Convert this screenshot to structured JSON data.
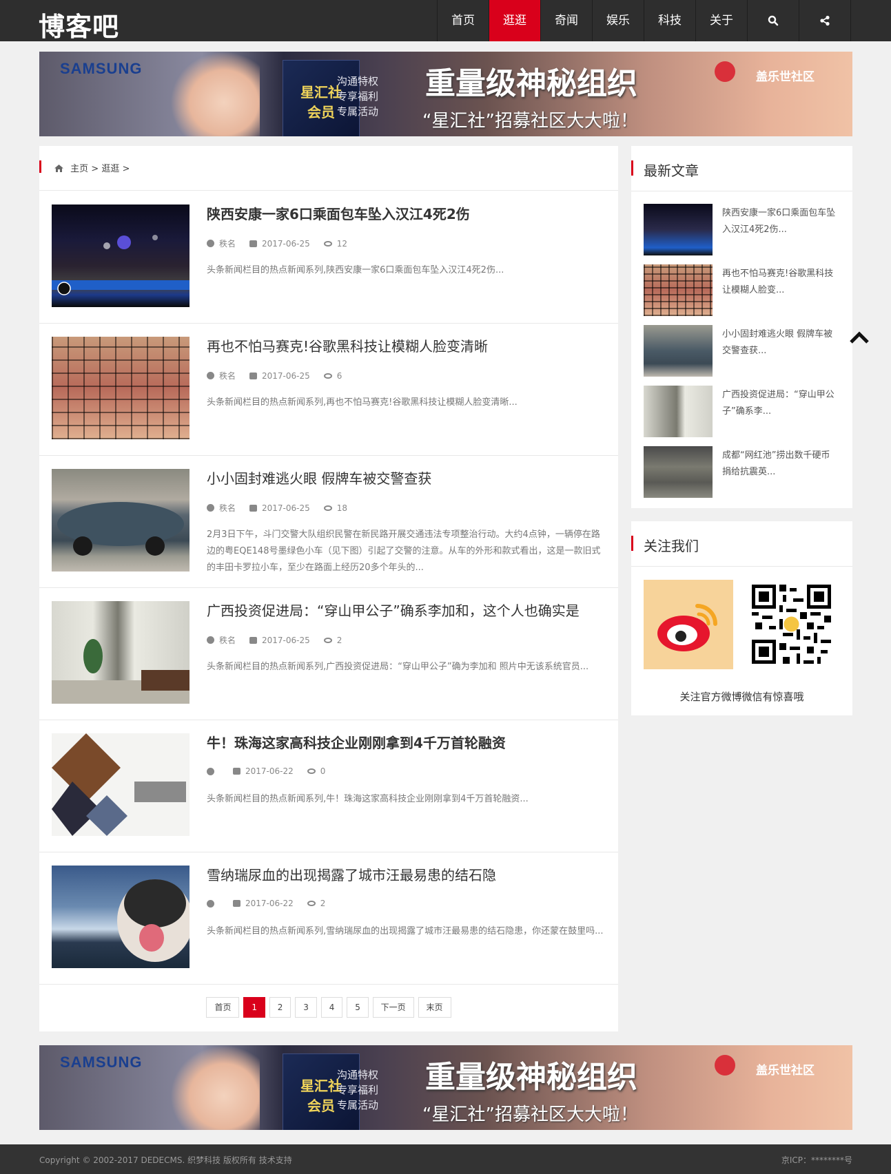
{
  "site": {
    "logo": "博客吧"
  },
  "nav": {
    "items": [
      "首页",
      "逛逛",
      "奇闻",
      "娱乐",
      "科技",
      "关于"
    ],
    "active": "逛逛"
  },
  "banner": {
    "brand_left": "SAMSUNG",
    "card_line1": "星汇社",
    "card_line2": "会员",
    "side_line1": "沟通特权",
    "side_line2": "专享福利",
    "side_line3": "专属活动",
    "headline": "重量级神秘组织",
    "subline": "“星汇社”招募社区大大啦！",
    "brand_right": "盖乐世社区"
  },
  "breadcrumb": {
    "home": "主页",
    "sep1": ">",
    "current": "逛逛",
    "sep2": ">"
  },
  "articles": [
    {
      "title": "陕西安康一家6口乘面包车坠入汉江4死2伤",
      "author": "秩名",
      "date": "2017-06-25",
      "views": "12",
      "desc": "头条新闻栏目的热点新闻系列,陕西安康一家6口乘面包车坠入汉江4死2伤..."
    },
    {
      "title": "再也不怕马赛克!谷歌黑科技让模糊人脸变清晰",
      "author": "秩名",
      "date": "2017-06-25",
      "views": "6",
      "desc": "头条新闻栏目的热点新闻系列,再也不怕马赛克!谷歌黑科技让模糊人脸变清晰..."
    },
    {
      "title": "小小固封难逃火眼 假牌车被交警查获",
      "author": "秩名",
      "date": "2017-06-25",
      "views": "18",
      "desc": "2月3日下午，斗门交警大队组织民警在新民路开展交通违法专项整治行动。大约4点钟，一辆停在路边的粤EQE148号墨绿色小车（见下图）引起了交警的注意。从车的外形和款式看出，这是一款旧式的丰田卡罗拉小车，至少在路面上经历20多个年头的..."
    },
    {
      "title": "广西投资促进局：“穿山甲公子”确系李加和，这个人也确实是",
      "author": "秩名",
      "date": "2017-06-25",
      "views": "2",
      "desc": "头条新闻栏目的热点新闻系列,广西投资促进局：“穿山甲公子”确为李加和 照片中无该系统官员..."
    },
    {
      "title": "牛！珠海这家高科技企业刚刚拿到4千万首轮融资",
      "author": "",
      "date": "2017-06-22",
      "views": "0",
      "desc": "头条新闻栏目的热点新闻系列,牛！珠海这家高科技企业刚刚拿到4千万首轮融资..."
    },
    {
      "title": "雪纳瑞尿血的出现揭露了城市汪最易患的结石隐",
      "author": "",
      "date": "2017-06-22",
      "views": "2",
      "desc": "头条新闻栏目的热点新闻系列,雪纳瑞尿血的出现揭露了城市汪最易患的结石隐患，你还蒙在鼓里吗..."
    }
  ],
  "pager": {
    "first": "首页",
    "pages": [
      "1",
      "2",
      "3",
      "4",
      "5"
    ],
    "current": "1",
    "next": "下一页",
    "last": "末页"
  },
  "sidebar": {
    "latest_title": "最新文章",
    "latest": [
      "陕西安康一家6口乘面包车坠入汉江4死2伤...",
      "再也不怕马赛克!谷歌黑科技让模糊人脸变...",
      "小小固封难逃火眼 假牌车被交警查获...",
      "广西投资促进局：“穿山甲公子”确系李...",
      "成都“网红池”捞出数千硬币 捐给抗震英..."
    ],
    "follow_title": "关注我们",
    "follow_text": "关注官方微博微信有惊喜哦"
  },
  "footer": {
    "copyright": "Copyright © 2002-2017 DEDECMS. 织梦科技 版权所有 技术支持",
    "icp": "京ICP：********号"
  },
  "colors": {
    "accent": "#d9001b",
    "header_bg": "#2e2e2e",
    "footer_bg": "#333333"
  }
}
